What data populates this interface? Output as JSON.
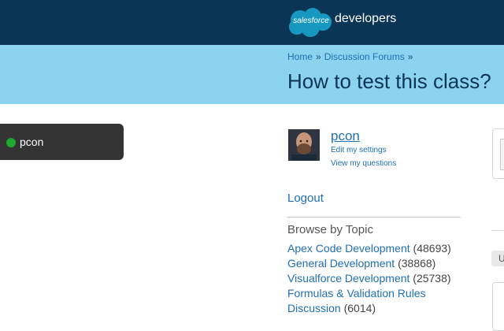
{
  "header": {
    "logo_cloud_text": "salesforce",
    "logo_text": "developers"
  },
  "breadcrumb": {
    "items": [
      "Home",
      "Discussion Forums"
    ],
    "separator": "»"
  },
  "page": {
    "title": "How to test this class?"
  },
  "sidebar": {
    "user_pill_name": "pcon",
    "status_color": "#1ea82e"
  },
  "profile": {
    "name": "pcon",
    "edit_settings": "Edit my settings",
    "view_questions": "View my questions",
    "logout": "Logout"
  },
  "browse": {
    "heading": "Browse by Topic",
    "topics": [
      {
        "label": "Apex Code Development",
        "count": "(48693)"
      },
      {
        "label": "General Development",
        "count": "(38868)"
      },
      {
        "label": "Visualforce Development",
        "count": "(25738)"
      },
      {
        "label": "Formulas & Validation Rules",
        "count": ""
      },
      {
        "label": "Discussion",
        "count": "(6014)"
      }
    ]
  },
  "right_panel": {
    "tag_text": "U"
  },
  "colors": {
    "header_bg": "#0b3554",
    "banner_bg": "#8cd3ef",
    "link": "#1f6fb2",
    "pill_bg": "#333333"
  }
}
